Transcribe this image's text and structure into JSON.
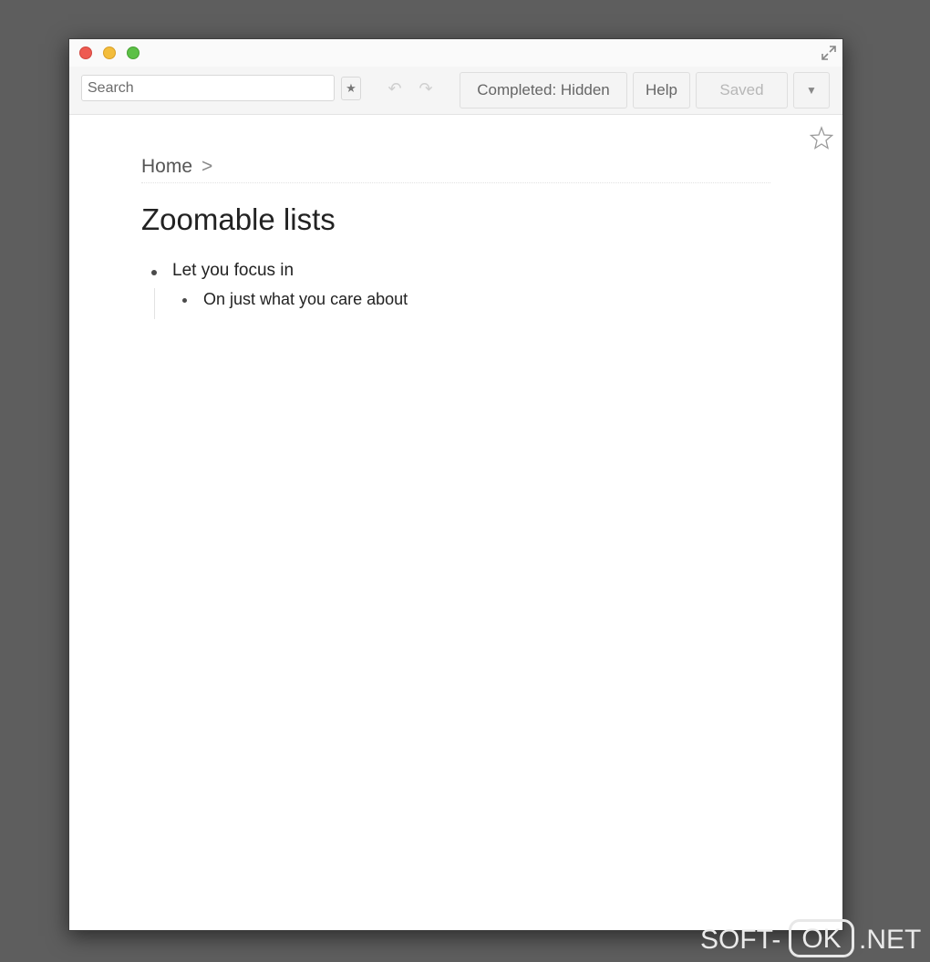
{
  "toolbar": {
    "search_placeholder": "Search",
    "star_label": "★",
    "undo_label": "↶",
    "redo_label": "↷",
    "completed_label": "Completed: Hidden",
    "help_label": "Help",
    "saved_label": "Saved",
    "menu_label": "▼"
  },
  "breadcrumb": {
    "home": "Home",
    "separator": ">"
  },
  "page": {
    "title": "Zoomable lists",
    "items": [
      {
        "text": "Let you focus in",
        "children": [
          {
            "text": "On just what you care about"
          }
        ]
      }
    ]
  },
  "watermark": {
    "left": "SOFT-",
    "box": "OK",
    "right": ".NET"
  },
  "colors": {
    "close": "#ee5a51",
    "minimize": "#f3bd3c",
    "maximize": "#5cc046"
  },
  "icons": [
    "close-icon",
    "minimize-icon",
    "maximize-icon",
    "fullscreen-icon",
    "star-icon",
    "undo-icon",
    "redo-icon",
    "chevron-down-icon"
  ]
}
